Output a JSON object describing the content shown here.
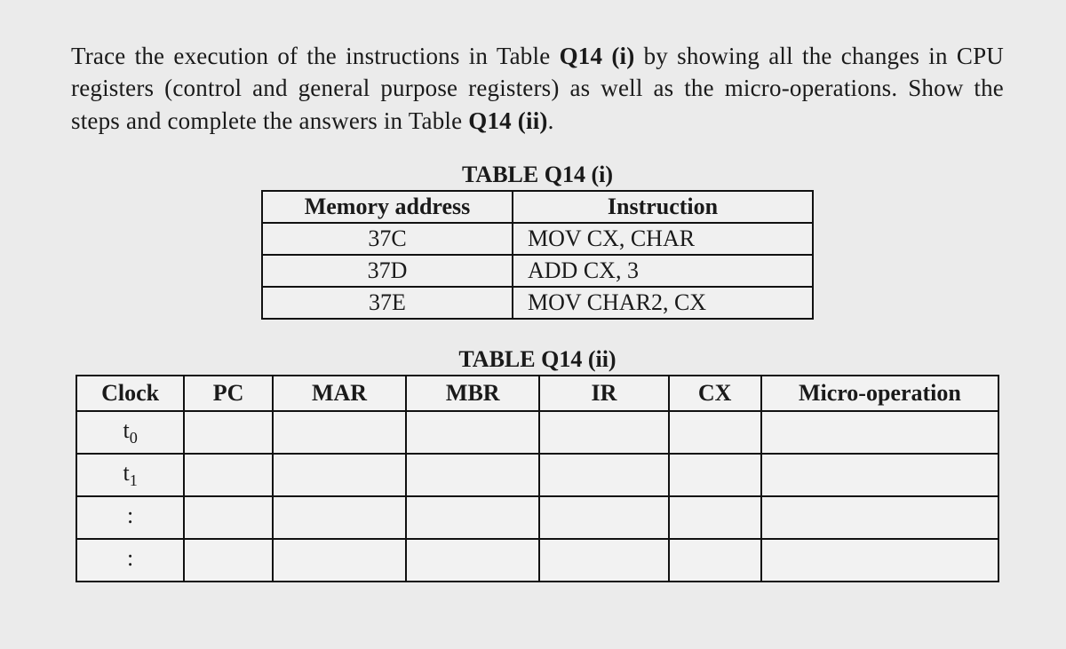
{
  "prompt": {
    "pre1": "Trace the execution of the instructions in Table ",
    "boldRef1": "Q14 (i)",
    "mid1": " by showing all the changes in CPU registers (control and general purpose registers) as well as the micro-operations. Show the steps and complete the answers in Table ",
    "boldRef2": "Q14 (ii)",
    "post": "."
  },
  "table1": {
    "title": "TABLE Q14 (i)",
    "headers": {
      "addr": "Memory address",
      "instr": "Instruction"
    },
    "rows": [
      {
        "addr": "37C",
        "instr": "MOV  CX, CHAR"
      },
      {
        "addr": "37D",
        "instr": "ADD  CX, 3"
      },
      {
        "addr": "37E",
        "instr": "MOV  CHAR2, CX"
      }
    ]
  },
  "table2": {
    "title": "TABLE Q14 (ii)",
    "headers": {
      "clock": "Clock",
      "pc": "PC",
      "mar": "MAR",
      "mbr": "MBR",
      "ir": "IR",
      "cx": "CX",
      "micro": "Micro-operation"
    },
    "rows": [
      {
        "clock_base": "t",
        "clock_sub": "0"
      },
      {
        "clock_base": "t",
        "clock_sub": "1"
      },
      {
        "clock_base": ":",
        "clock_sub": ""
      },
      {
        "clock_base": ":",
        "clock_sub": ""
      }
    ]
  }
}
